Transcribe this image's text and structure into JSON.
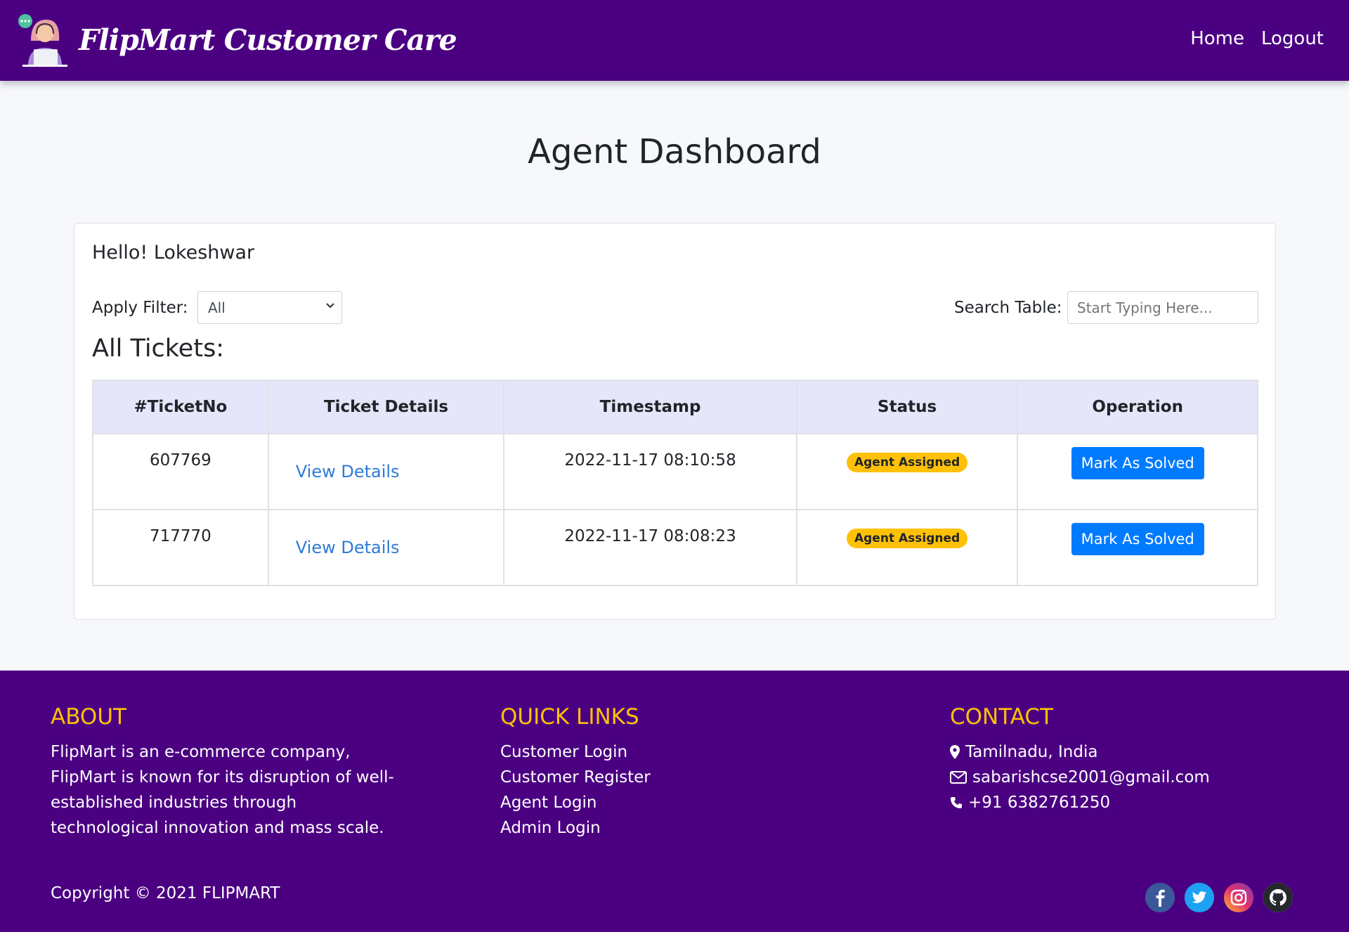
{
  "header": {
    "brand": "FlipMart Customer Care",
    "nav": [
      {
        "label": "Home"
      },
      {
        "label": "Logout"
      }
    ]
  },
  "page": {
    "title": "Agent Dashboard"
  },
  "card": {
    "greeting": "Hello! Lokeshwar",
    "filter_label": "Apply Filter:",
    "filter_value": "All",
    "search_label": "Search Table:",
    "search_placeholder": "Start Typing Here...",
    "tickets_heading": "All Tickets:"
  },
  "table": {
    "headers": [
      "#TicketNo",
      "Ticket Details",
      "Timestamp",
      "Status",
      "Operation"
    ],
    "rows": [
      {
        "ticket_no": "607769",
        "details_link": "View Details",
        "timestamp": "2022-11-17 08:10:58",
        "status": "Agent Assigned",
        "operation": "Mark As Solved"
      },
      {
        "ticket_no": "717770",
        "details_link": "View Details",
        "timestamp": "2022-11-17 08:08:23",
        "status": "Agent Assigned",
        "operation": "Mark As Solved"
      }
    ]
  },
  "footer": {
    "about": {
      "title": "ABOUT",
      "text": "FlipMart is an e-commerce company, FlipMart is known for its disruption of well-established industries through technological innovation and mass scale."
    },
    "quick_links": {
      "title": "QUICK LINKS",
      "items": [
        "Customer Login",
        "Customer Register",
        "Agent Login",
        "Admin Login"
      ]
    },
    "contact": {
      "title": "CONTACT",
      "location": "Tamilnadu, India",
      "email": "sabarishcse2001@gmail.com",
      "phone": "+91 6382761250"
    },
    "copyright": "Copyright © 2021 FLIPMART",
    "socials": [
      "facebook-icon",
      "twitter-icon",
      "instagram-icon",
      "github-icon"
    ]
  },
  "colors": {
    "brand_purple": "#4b0082",
    "accent_yellow": "#ffc107",
    "button_blue": "#007bff",
    "table_header": "#e6e6fa"
  }
}
